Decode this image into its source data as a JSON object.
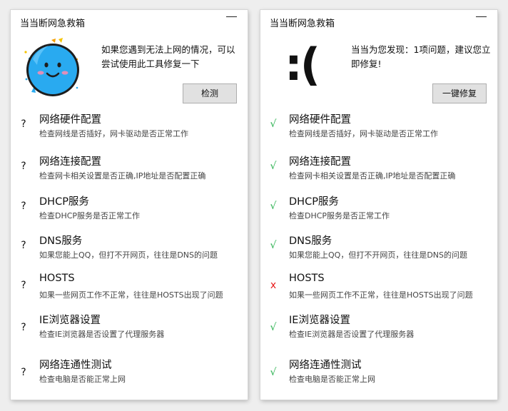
{
  "left": {
    "title": "当当断网急救箱",
    "message": "如果您遇到无法上网的情况，可以尝试使用此工具修复一下",
    "button": "检测",
    "items": [
      {
        "status": "?",
        "title": "网络硬件配置",
        "desc": "检查网线是否插好，网卡驱动是否正常工作"
      },
      {
        "status": "?",
        "title": "网络连接配置",
        "desc": "检查网卡相关设置是否正确,IP地址是否配置正确"
      },
      {
        "status": "?",
        "title": "DHCP服务",
        "desc": "检查DHCP服务是否正常工作"
      },
      {
        "status": "?",
        "title": "DNS服务",
        "desc": "如果您能上QQ，但打不开网页，往往是DNS的问题"
      },
      {
        "status": "?",
        "title": "HOSTS",
        "desc": "如果一些网页工作不正常，往往是HOSTS出现了问题"
      },
      {
        "status": "?",
        "title": "IE浏览器设置",
        "desc": "检查IE浏览器是否设置了代理服务器"
      },
      {
        "status": "?",
        "title": "网络连通性测试",
        "desc": "检查电脑是否能正常上网"
      }
    ]
  },
  "right": {
    "title": "当当断网急救箱",
    "sad_face": ":(",
    "message": "当当为您发现：1项问题，建议您立即修复!",
    "button": "一键修复",
    "items": [
      {
        "status": "√",
        "title": "网络硬件配置",
        "desc": "检查网线是否插好，网卡驱动是否正常工作"
      },
      {
        "status": "√",
        "title": "网络连接配置",
        "desc": "检查网卡相关设置是否正确,IP地址是否配置正确"
      },
      {
        "status": "√",
        "title": "DHCP服务",
        "desc": "检查DHCP服务是否正常工作"
      },
      {
        "status": "√",
        "title": "DNS服务",
        "desc": "如果您能上QQ，但打不开网页，往往是DNS的问题"
      },
      {
        "status": "x",
        "title": "HOSTS",
        "desc": "如果一些网页工作不正常，往往是HOSTS出现了问题"
      },
      {
        "status": "√",
        "title": "IE浏览器设置",
        "desc": "检查IE浏览器是否设置了代理服务器"
      },
      {
        "status": "√",
        "title": "网络连通性测试",
        "desc": "检查电脑是否能正常上网"
      }
    ]
  },
  "colors": {
    "ok": "#27b04d",
    "error": "#e81919",
    "face": "#29aaf0"
  }
}
